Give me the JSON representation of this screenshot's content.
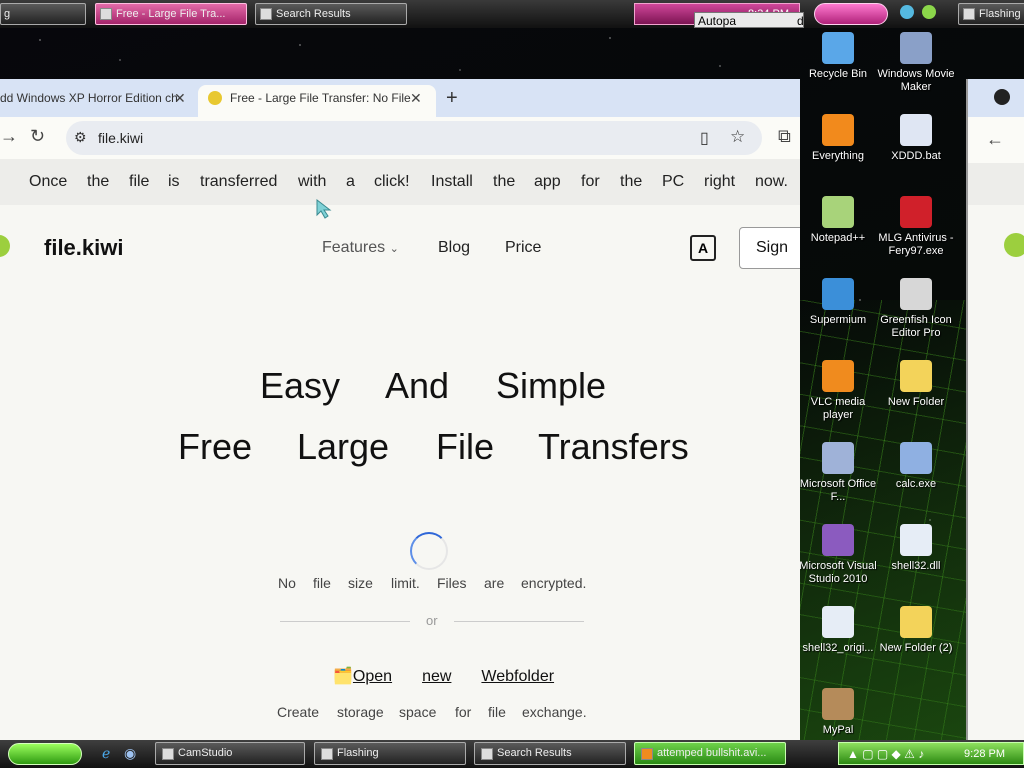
{
  "top_taskbar": {
    "left_item": "g",
    "buttons": [
      "Free - Large File Tra...",
      "Search Results"
    ],
    "clock": "8:34 PM",
    "popup_text": "Autopa",
    "popup_suffix": "d",
    "right_button": "Flashing"
  },
  "browser": {
    "tabs": [
      {
        "label": "dd Windows XP Horror Edition ch"
      },
      {
        "label": "Free - Large File Transfer: No File"
      }
    ],
    "url": "file.kiwi",
    "banner_words": [
      "Once",
      "the",
      "file",
      "is",
      "transferred",
      "with",
      "a",
      "click!",
      "Install",
      "the",
      "app",
      "for",
      "the",
      "PC",
      "right",
      "now."
    ],
    "site": {
      "logo": "file.kiwi",
      "nav": [
        "Features",
        "Blog",
        "Price"
      ],
      "sign_label": "Sign",
      "translate_glyph": "A",
      "hero_line1": [
        "Easy",
        "And",
        "Simple"
      ],
      "hero_line2": [
        "Free",
        "Large",
        "File",
        "Transfers"
      ],
      "subtitle": [
        "No",
        "file",
        "size",
        "limit.",
        "Files",
        "are",
        "encrypted."
      ],
      "or_label": "or",
      "link_icon": "🗂️",
      "link_words": [
        "Open",
        "new",
        "Webfolder"
      ],
      "caption": [
        "Create",
        "storage",
        "space",
        "for",
        "file",
        "exchange."
      ]
    }
  },
  "desktop_icons": [
    {
      "label": "Recycle Bin",
      "icon": "recycle-bin-icon",
      "color": "#5aa7e8"
    },
    {
      "label": "Windows Movie Maker",
      "icon": "movie-maker-icon",
      "color": "#8aa0c8"
    },
    {
      "label": "Everything",
      "icon": "everything-icon",
      "color": "#f28a1c"
    },
    {
      "label": "XDDD.bat",
      "icon": "bat-file-icon",
      "color": "#dfe6f3"
    },
    {
      "label": "Notepad++",
      "icon": "notepad-plus-icon",
      "color": "#a8d37a"
    },
    {
      "label": "MLG Antivirus - Fery97.exe",
      "icon": "mlg-antivirus-icon",
      "color": "#d0202a"
    },
    {
      "label": "Supermium",
      "icon": "supermium-icon",
      "color": "#3b8fd9"
    },
    {
      "label": "Greenfish Icon Editor Pro",
      "icon": "greenfish-icon",
      "color": "#d7d7d7"
    },
    {
      "label": "VLC media player",
      "icon": "vlc-icon",
      "color": "#f08b1e"
    },
    {
      "label": "New Folder",
      "icon": "folder-icon",
      "color": "#f3d35a"
    },
    {
      "label": "Microsoft Office F...",
      "icon": "office-icon",
      "color": "#9fb2d8"
    },
    {
      "label": "calc.exe",
      "icon": "calculator-icon",
      "color": "#8fb0e2"
    },
    {
      "label": "Microsoft Visual Studio 2010",
      "icon": "visual-studio-icon",
      "color": "#8b5bbf"
    },
    {
      "label": "shell32.dll",
      "icon": "dll-file-icon",
      "color": "#e6edf6"
    },
    {
      "label": "shell32_origi...",
      "icon": "dll-file-icon",
      "color": "#e6edf6"
    },
    {
      "label": "New Folder (2)",
      "icon": "folder-icon",
      "color": "#f3d35a"
    },
    {
      "label": "MyPal",
      "icon": "mypal-icon",
      "color": "#b58b5a"
    }
  ],
  "bottom_taskbar": {
    "buttons": [
      "CamStudio",
      "Flashing",
      "Search Results",
      "attemped bullshit.avi..."
    ],
    "clock": "9:28 PM"
  }
}
